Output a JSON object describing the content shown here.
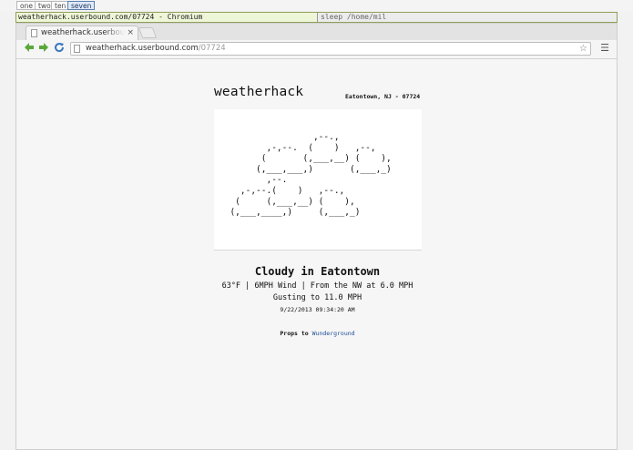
{
  "wm": {
    "tags": [
      "one",
      "two",
      "ten",
      "seven"
    ],
    "active_tag": "seven",
    "window_title": "weatherhack.userbound.com/07724 - Chromium",
    "status_right": "sleep  /home/mil"
  },
  "browser": {
    "tab_title": "weatherhack.userbound.com",
    "tab_close": "×",
    "url_host": "weatherhack.userbound.com",
    "url_path": "/07724",
    "icons": {
      "back": "arrow-left-icon",
      "forward": "arrow-right-icon",
      "reload": "reload-icon",
      "star": "star-icon",
      "menu": "hamburger-menu-icon"
    }
  },
  "page": {
    "site_title": "weatherhack",
    "location": "Eatontown, NJ - 07724",
    "ascii_art": [
      "                  ,--.,",
      "         ,-,--.  (    )   ,--,",
      "        (       (,___,__) (    ),",
      "       (,___,___,)       (,___,_)",
      "         ,--.",
      "    ,-,--.(    )   ,--.,",
      "   (     (,___,__) (    ),",
      "  (,___,____,)     (,___,_)"
    ],
    "conditions": "Cloudy in Eatontown",
    "details": "63°F | 6MPH Wind | From the NW at 6.0 MPH",
    "gusting": "Gusting to 11.0 MPH",
    "timestamp": "9/22/2013 09:34:20 AM",
    "props_label": "Props to",
    "props_link": "Wunderground"
  }
}
